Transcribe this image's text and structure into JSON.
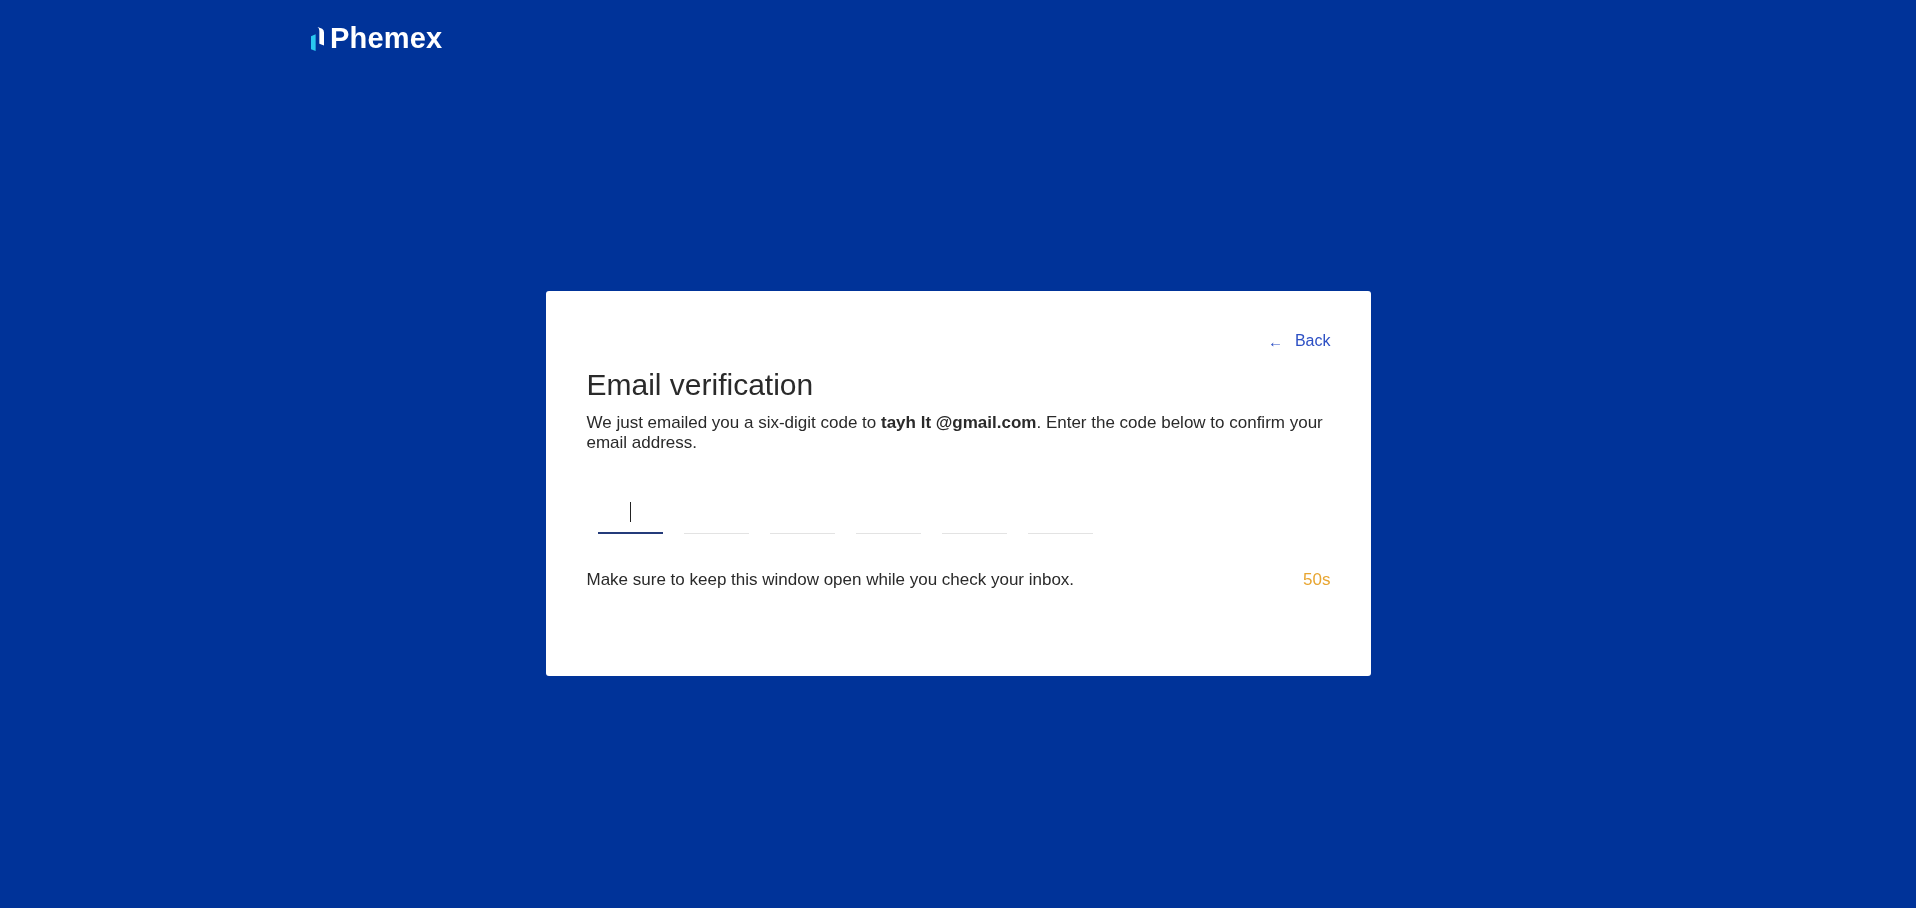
{
  "header": {
    "logo_text": "Phemex"
  },
  "card": {
    "back_link": {
      "icon": "←",
      "label": "Back"
    },
    "title": "Email verification",
    "message": "We just emailed you a six-digit code to **tayh lt @gmail.com**. Enter the code below to confirm your email address.",
    "code_fields": [
      {
        "focused": true
      },
      {
        "focused": false
      },
      {
        "focused": false
      },
      {
        "focused": false
      },
      {
        "focused": false
      },
      {
        "focused": false
      }
    ],
    "note": "Make sure to keep this window open while you check your inbox.",
    "countdown": "50s"
  }
}
